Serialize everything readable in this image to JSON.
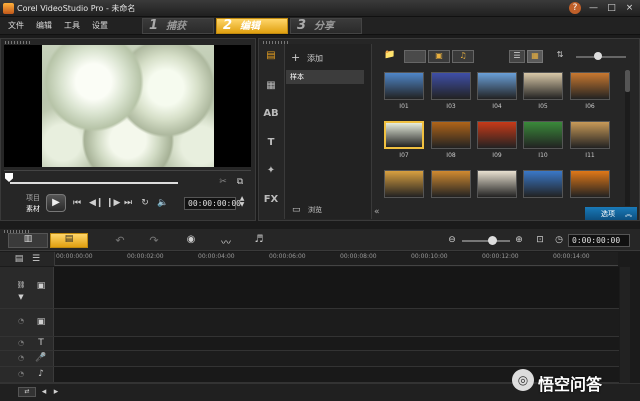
{
  "window": {
    "title": "Corel VideoStudio Pro - 未命名",
    "help": "?",
    "minimize": "—",
    "close": "×"
  },
  "menu": [
    "文件",
    "编辑",
    "工具",
    "设置"
  ],
  "steps": [
    {
      "num": "1",
      "label": "捕获"
    },
    {
      "num": "2",
      "label": "编辑"
    },
    {
      "num": "3",
      "label": "分享"
    }
  ],
  "player": {
    "mode_project": "项目",
    "mode_clip": "素材",
    "timecode": "00:00:00:00",
    "progress": 0.0
  },
  "library": {
    "add_label": "添加",
    "folders": [
      "样本"
    ],
    "browse_label": "浏览",
    "options_label": "选项",
    "thumbs": [
      {
        "label": "I01",
        "color": "#4f86c8"
      },
      {
        "label": "I03",
        "color": "#3f4fa8"
      },
      {
        "label": "I04",
        "color": "#6aa0d8"
      },
      {
        "label": "I05",
        "color": "#d8c8a8"
      },
      {
        "label": "I06",
        "color": "#c87830"
      },
      {
        "label": "I07",
        "color": "#e6ecdc",
        "selected": true
      },
      {
        "label": "I08",
        "color": "#b06418"
      },
      {
        "label": "I09",
        "color": "#c83a18"
      },
      {
        "label": "I10",
        "color": "#3a8a3a"
      },
      {
        "label": "I11",
        "color": "#c89a58"
      },
      {
        "label": "",
        "color": "#d8a040"
      },
      {
        "label": "",
        "color": "#d08a30"
      },
      {
        "label": "",
        "color": "#e8e0d0"
      },
      {
        "label": "",
        "color": "#3a78c8"
      },
      {
        "label": "",
        "color": "#e07818"
      }
    ]
  },
  "timeline": {
    "timecode": "0:00:00:00",
    "ruler": [
      "00:00:00:00",
      "00:00:02:00",
      "00:00:04:00",
      "00:00:06:00",
      "00:00:08:00",
      "00:00:10:00",
      "00:00:12:00",
      "00:00:14:00"
    ]
  },
  "watermark": "悟空问答"
}
